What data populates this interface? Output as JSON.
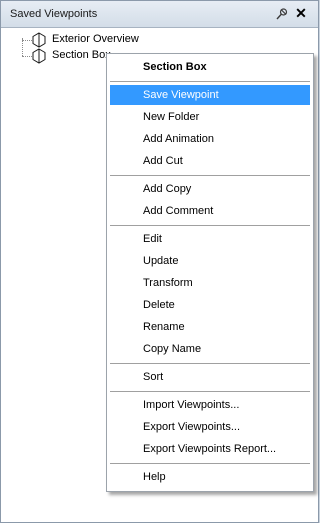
{
  "panel": {
    "title": "Saved Viewpoints",
    "pin_icon": "pin-icon",
    "close_icon": "close-icon",
    "close_glyph": "✕"
  },
  "tree": {
    "items": [
      {
        "label": "Exterior Overview",
        "icon": "viewpoint-icon"
      },
      {
        "label": "Section Box",
        "icon": "viewpoint-icon"
      }
    ]
  },
  "menu": {
    "header": "Section Box",
    "highlighted_color": "#3399ff",
    "items": {
      "save_viewpoint": "Save Viewpoint",
      "new_folder": "New Folder",
      "add_animation": "Add Animation",
      "add_cut": "Add Cut",
      "add_copy": "Add Copy",
      "add_comment": "Add Comment",
      "edit": "Edit",
      "update": "Update",
      "transform": "Transform",
      "delete": "Delete",
      "rename": "Rename",
      "copy_name": "Copy Name",
      "sort": "Sort",
      "import_viewpoints": "Import Viewpoints...",
      "export_viewpoints": "Export Viewpoints...",
      "export_report": "Export Viewpoints Report...",
      "help": "Help"
    }
  }
}
